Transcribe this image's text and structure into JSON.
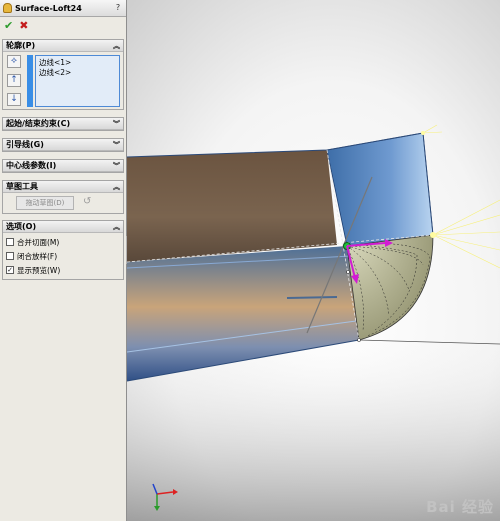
{
  "panel": {
    "title": "Surface-Loft24",
    "help": "?",
    "ok_symbol": "✔",
    "cancel_symbol": "✖"
  },
  "profile": {
    "header": "轮廓(P)",
    "items": [
      "边线<1>",
      "边线<2>"
    ]
  },
  "start_end": {
    "header": "起始/结束约束(C)"
  },
  "guides": {
    "header": "引导线(G)"
  },
  "centerline": {
    "header": "中心线参数(I)"
  },
  "sketch_tools": {
    "header": "草图工具",
    "drag_button": "拖动草图(D)"
  },
  "options": {
    "header": "选项(O)",
    "items": [
      {
        "label": "合并切面(M)",
        "checked": false
      },
      {
        "label": "闭合放样(F)",
        "checked": false
      },
      {
        "label": "显示预览(W)",
        "checked": true
      }
    ]
  },
  "watermark": "Bai 经验",
  "colors": {
    "panel_bg": "#eceae3",
    "accent_blue": "#3a8ee6",
    "list_bg": "#e2ecf8"
  }
}
